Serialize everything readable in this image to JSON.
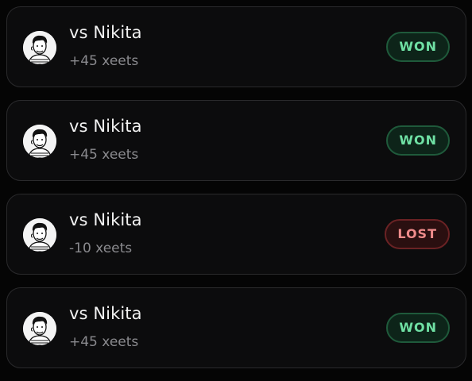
{
  "matches": [
    {
      "title": "vs Nikita",
      "delta": "+45 xeets",
      "result": "WON",
      "status": "won",
      "avatar_icon": "player-avatar-icon"
    },
    {
      "title": "vs Nikita",
      "delta": "+45 xeets",
      "result": "WON",
      "status": "won",
      "avatar_icon": "player-avatar-icon"
    },
    {
      "title": "vs Nikita",
      "delta": "-10 xeets",
      "result": "LOST",
      "status": "lost",
      "avatar_icon": "player-avatar-icon"
    },
    {
      "title": "vs Nikita",
      "delta": "+45 xeets",
      "result": "WON",
      "status": "won",
      "avatar_icon": "player-avatar-icon"
    }
  ],
  "colors": {
    "won_text": "#6fe0a4",
    "won_bg": "#0d2419",
    "lost_text": "#ef8b8b",
    "lost_bg": "#2a0f10",
    "card_bg": "#0c0c0d",
    "card_border": "#2a2a2c"
  }
}
